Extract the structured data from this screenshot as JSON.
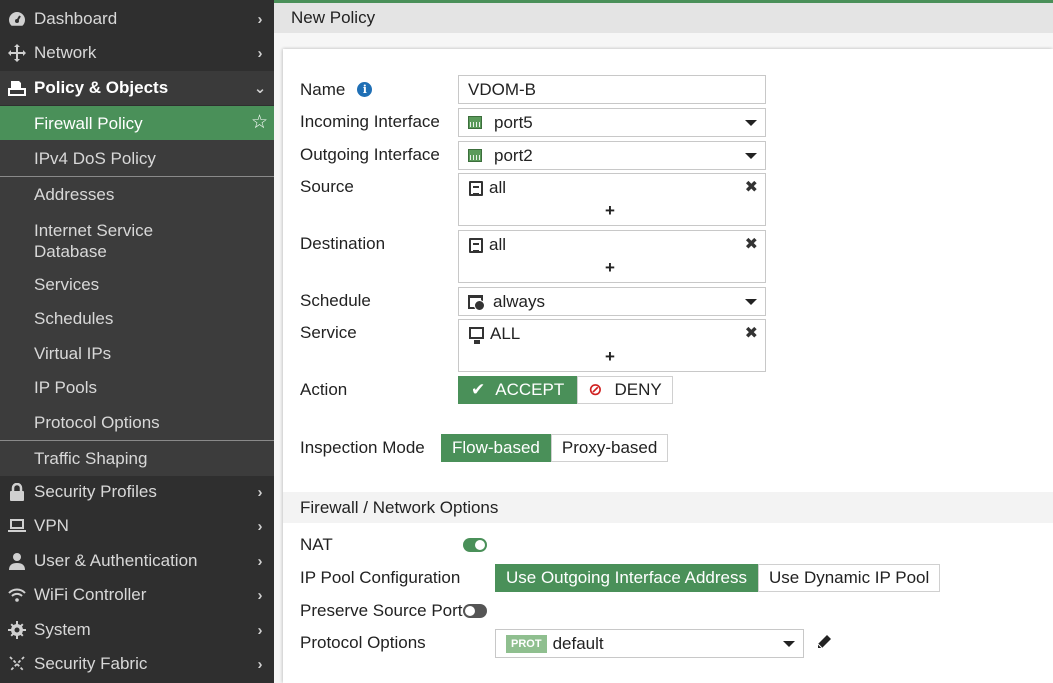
{
  "sidebar": {
    "items": [
      {
        "label": "Dashboard",
        "icon": "dashboard-icon"
      },
      {
        "label": "Network",
        "icon": "network-move-icon"
      },
      {
        "label": "Policy & Objects",
        "icon": "policy-icon",
        "expanded": true
      },
      {
        "label": "Security Profiles",
        "icon": "lock-icon"
      },
      {
        "label": "VPN",
        "icon": "laptop-icon"
      },
      {
        "label": "User & Authentication",
        "icon": "user-icon"
      },
      {
        "label": "WiFi Controller",
        "icon": "wifi-icon"
      },
      {
        "label": "System",
        "icon": "gear-icon"
      },
      {
        "label": "Security Fabric",
        "icon": "fabric-icon"
      }
    ],
    "subitems": [
      {
        "label": "Firewall Policy",
        "active": true
      },
      {
        "label": "IPv4 DoS Policy"
      },
      {
        "label": "Addresses"
      },
      {
        "label": "Internet Service Database"
      },
      {
        "label": "Services"
      },
      {
        "label": "Schedules"
      },
      {
        "label": "Virtual IPs"
      },
      {
        "label": "IP Pools"
      },
      {
        "label": "Protocol Options"
      },
      {
        "label": "Traffic Shaping"
      }
    ]
  },
  "header": {
    "title": "New Policy"
  },
  "form": {
    "name": {
      "label": "Name",
      "value": "VDOM-B"
    },
    "incoming": {
      "label": "Incoming Interface",
      "value": "port5"
    },
    "outgoing": {
      "label": "Outgoing Interface",
      "value": "port2"
    },
    "source": {
      "label": "Source",
      "value": "all",
      "add": "+",
      "remove": "✖"
    },
    "destination": {
      "label": "Destination",
      "value": "all",
      "add": "+",
      "remove": "✖"
    },
    "schedule": {
      "label": "Schedule",
      "value": "always"
    },
    "service": {
      "label": "Service",
      "value": "ALL",
      "add": "+",
      "remove": "✖"
    },
    "action": {
      "label": "Action",
      "options": [
        "ACCEPT",
        "DENY"
      ],
      "selected": "ACCEPT"
    },
    "inspection": {
      "label": "Inspection Mode",
      "options": [
        "Flow-based",
        "Proxy-based"
      ],
      "selected": "Flow-based"
    }
  },
  "firewall_options": {
    "title": "Firewall / Network Options",
    "nat": {
      "label": "NAT",
      "enabled": true
    },
    "ip_pool": {
      "label": "IP Pool Configuration",
      "options": [
        "Use Outgoing Interface Address",
        "Use Dynamic IP Pool"
      ],
      "selected": "Use Outgoing Interface Address"
    },
    "preserve_port": {
      "label": "Preserve Source Port",
      "enabled": false
    },
    "protocol_options": {
      "label": "Protocol Options",
      "badge": "PROT",
      "value": "default"
    }
  },
  "colors": {
    "accent": "#4a9059",
    "sidebar_bg": "#2f2f2f",
    "deny": "#d02020",
    "info": "#1f6fb5"
  }
}
